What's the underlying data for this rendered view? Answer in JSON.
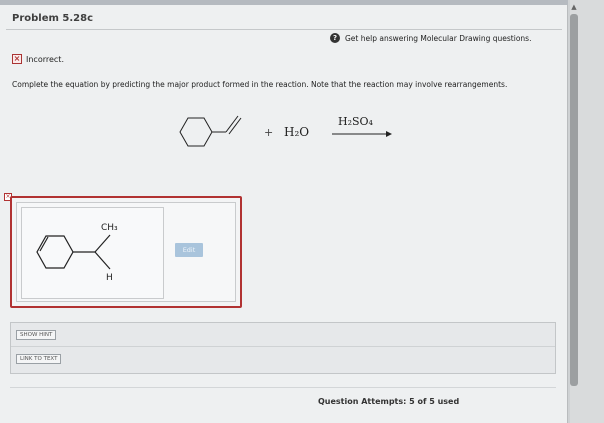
{
  "problem": {
    "title": "Problem 5.28c",
    "help_link": "Get help answering Molecular Drawing questions.",
    "help_icon": "question-circle-icon",
    "status": "Incorrect.",
    "instructions": "Complete the equation by predicting the major product formed in the reaction. Note that the reaction may involve rearrangements."
  },
  "reaction": {
    "plus": "+",
    "reactant2": "H₂O",
    "reagent": "H₂SO₄"
  },
  "answer": {
    "label_ch3": "CH₃",
    "label_h": "H",
    "edit_label": "Edit",
    "status_color": "#b13232"
  },
  "hints": {
    "show_hint": "SHOW HINT",
    "link_to_text": "LINK TO TEXT"
  },
  "attempts": {
    "text": "Question Attempts: 5 of 5 used"
  }
}
